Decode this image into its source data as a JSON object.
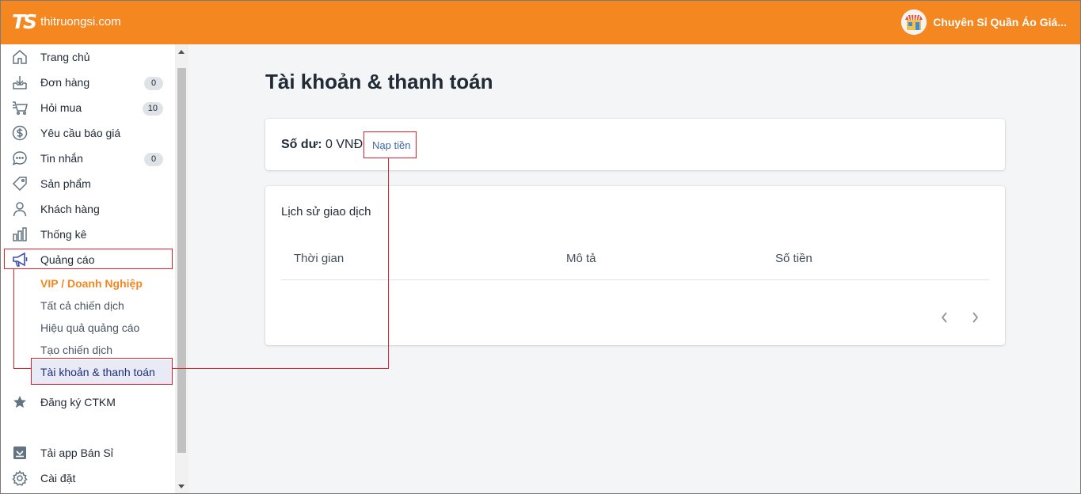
{
  "header": {
    "logo_mark": "TS",
    "logo_text": "thitruongsi.com",
    "store_name": "Chuyên Sỉ Quần Áo Giá..."
  },
  "sidebar": {
    "items": [
      {
        "label": "Trang chủ",
        "icon": "home-icon"
      },
      {
        "label": "Đơn hàng",
        "icon": "download-tray-icon",
        "badge": "0"
      },
      {
        "label": "Hỏi mua",
        "icon": "cart-list-icon",
        "badge": "10"
      },
      {
        "label": "Yêu cầu báo giá",
        "icon": "dollar-circle-icon"
      },
      {
        "label": "Tin nhắn",
        "icon": "chat-bubble-icon",
        "badge": "0"
      },
      {
        "label": "Sản phẩm",
        "icon": "tag-icon"
      },
      {
        "label": "Khách hàng",
        "icon": "person-icon"
      },
      {
        "label": "Thống kê",
        "icon": "bar-chart-icon"
      },
      {
        "label": "Quảng cáo",
        "icon": "megaphone-icon"
      },
      {
        "label": "Đăng ký CTKM",
        "icon": "star-icon"
      },
      {
        "label": "Tải app Bán Sỉ",
        "icon": "download-box-icon"
      },
      {
        "label": "Cài đặt",
        "icon": "gear-icon"
      }
    ],
    "ads_sub": [
      "VIP / Doanh Nghiệp",
      "Tất cả chiến dịch",
      "Hiệu quả quảng cáo",
      "Tạo chiến dịch",
      "Tài khoản & thanh toán"
    ]
  },
  "main": {
    "title": "Tài khoản & thanh toán",
    "balance_label": "Số dư:",
    "balance_value": "0 VNĐ",
    "topup_link": "Nạp tiền",
    "history_title": "Lịch sử giao dịch",
    "columns": [
      "Thời gian",
      "Mô tả",
      "Số tiền"
    ]
  },
  "colors": {
    "brand": "#f58720",
    "annotation": "#e0202d",
    "active_bg": "#e8ebf6",
    "link": "#3b69a8"
  }
}
